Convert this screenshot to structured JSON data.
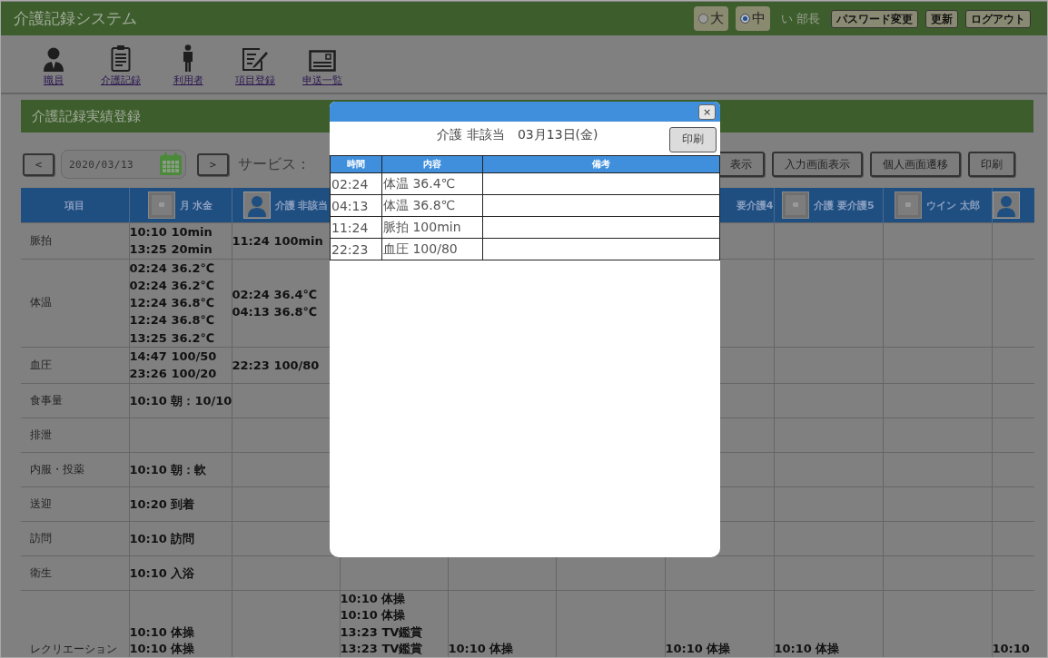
{
  "app": {
    "title": "介護記録システム"
  },
  "font_size": [
    {
      "label": "大",
      "selected": false
    },
    {
      "label": "中",
      "selected": true
    }
  ],
  "user": "い 部長",
  "header_buttons": [
    "パスワード変更",
    "更新",
    "ログアウト"
  ],
  "nav": [
    {
      "label": "職員",
      "kind": "staff"
    },
    {
      "label": "介護記録",
      "kind": "clipboard"
    },
    {
      "label": "利用者",
      "kind": "person"
    },
    {
      "label": "項目登録",
      "kind": "register"
    },
    {
      "label": "申送一覧",
      "kind": "card"
    }
  ],
  "section_title": "介護記録実績登録",
  "toolbar": {
    "prev": "<",
    "date": "2020/03/13",
    "next": ">",
    "service_label": "サービス：",
    "buttons": [
      "表示",
      "入力画面表示",
      "個人画面遷移",
      "印刷"
    ]
  },
  "table": {
    "columns": [
      {
        "label": "項目"
      },
      {
        "label": "月 水金",
        "kind": "placeholder"
      },
      {
        "label": "介護 非該当",
        "kind": "person"
      },
      {},
      {},
      {},
      {
        "label": "要介護4"
      },
      {
        "label": "介護 要介護5",
        "kind": "placeholder"
      },
      {
        "label": "ウイン 太郎",
        "kind": "placeholder"
      },
      {
        "kind": "person"
      }
    ],
    "rows": [
      {
        "cells": [
          "脈拍",
          "10:10 10min\n13:25 20min",
          "11:24 100min",
          "",
          "",
          "",
          "",
          "",
          "",
          ""
        ]
      },
      {
        "cells": [
          "体温",
          "02:24 36.2℃\n02:24 36.2℃\n12:24 36.8℃\n12:24 36.8℃\n13:25 36.2℃",
          "02:24 36.4℃\n04:13 36.8℃",
          "",
          "",
          "",
          "",
          "",
          "",
          ""
        ]
      },
      {
        "cells": [
          "血圧",
          "14:47 100/50\n23:26 100/20",
          "22:23 100/80",
          "",
          "",
          "",
          "",
          "",
          "",
          ""
        ]
      },
      {
        "cells": [
          "食事量",
          "10:10 朝：10/10",
          "",
          "",
          "",
          "",
          "",
          "",
          "",
          ""
        ]
      },
      {
        "cells": [
          "排泄",
          "",
          "",
          "",
          "",
          "",
          "",
          "",
          "",
          ""
        ]
      },
      {
        "cells": [
          "内服・投薬",
          "10:10 朝：軟",
          "",
          "",
          "",
          "",
          "",
          "",
          "",
          ""
        ]
      },
      {
        "cells": [
          "送迎",
          "10:20 到着",
          "",
          "",
          "",
          "",
          "",
          "",
          "",
          ""
        ]
      },
      {
        "cells": [
          "訪問",
          "10:10 訪問",
          "",
          "",
          "",
          "",
          "",
          "",
          "",
          ""
        ]
      },
      {
        "cells": [
          "衛生",
          "10:10 入浴",
          "",
          "",
          "",
          "",
          "",
          "",
          "",
          ""
        ]
      },
      {
        "cells": [
          "レクリエーション",
          "10:10 体操\n10:10 体操",
          "",
          "10:10 体操\n10:10 体操\n13:23 TV鑑賞\n13:23 TV鑑賞",
          "10:10 体操",
          "",
          "10:10 体操",
          "10:10 体操",
          "",
          "10:10"
        ]
      }
    ]
  },
  "dialog": {
    "close": "×",
    "heading": "介護 非該当　03月13日(金)",
    "print": "印刷",
    "columns": [
      "時間",
      "内容",
      "備考"
    ],
    "rows": [
      {
        "time": "02:24",
        "content": "体温 36.4℃"
      },
      {
        "time": "04:13",
        "content": "体温 36.8℃"
      },
      {
        "time": "11:24",
        "content": "脈拍 100min"
      },
      {
        "time": "22:23",
        "content": "血圧 100/80"
      }
    ]
  }
}
